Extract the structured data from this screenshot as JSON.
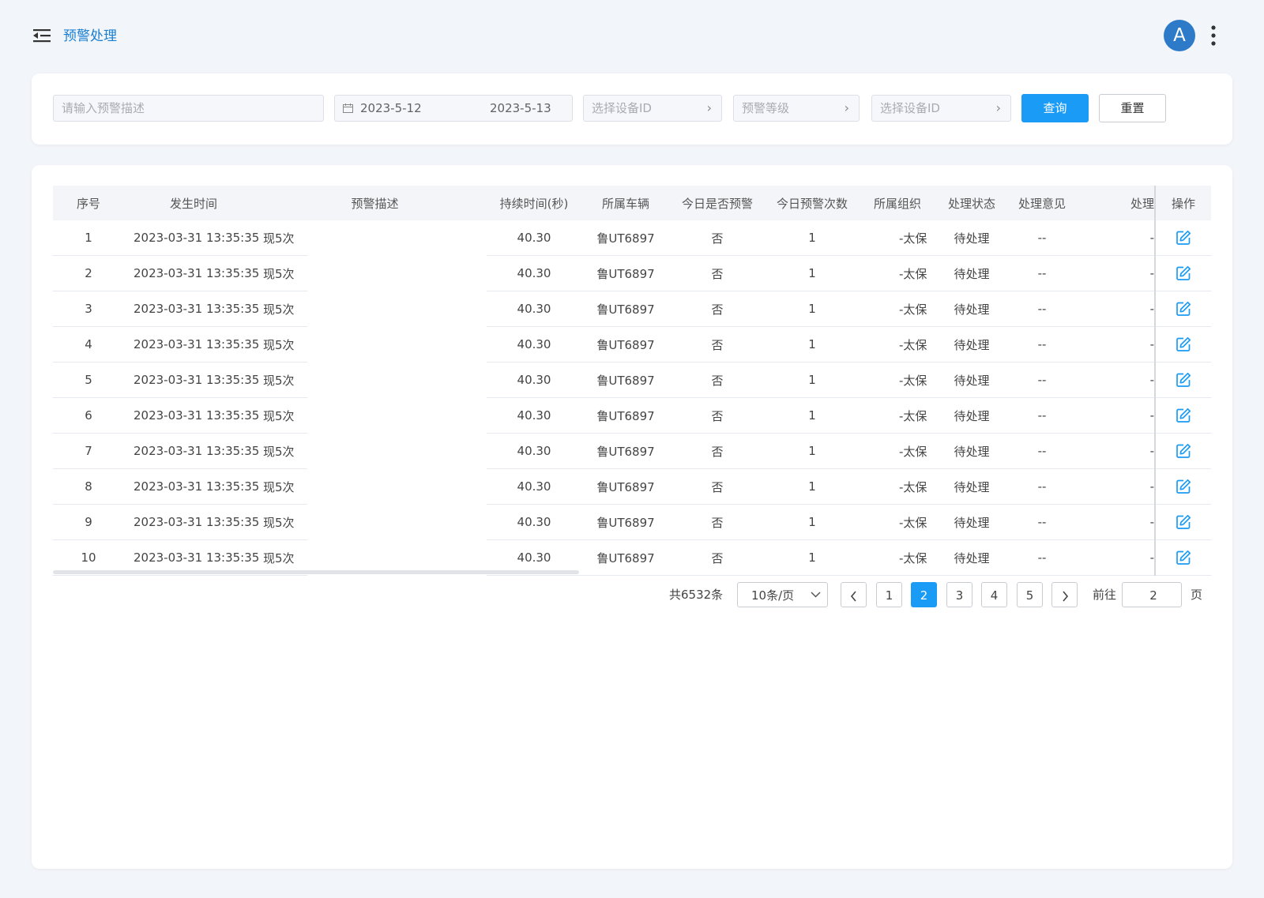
{
  "header": {
    "title": "预警处理",
    "avatar_letter": "A"
  },
  "filters": {
    "desc_placeholder": "请输入预警描述",
    "date_start": "2023-5-12",
    "date_end": "2023-5-13",
    "device_placeholder": "选择设备ID",
    "level_placeholder": "预警等级",
    "device2_placeholder": "选择设备ID",
    "query_label": "查询",
    "reset_label": "重置"
  },
  "table": {
    "columns": [
      "序号",
      "发生时间",
      "预警描述",
      "持续时间(秒)",
      "所属车辆",
      "今日是否预警",
      "今日预警次数",
      "所属组织",
      "处理状态",
      "处理意见",
      "处理",
      "操作"
    ],
    "rows": [
      {
        "index": "1",
        "time": "2023-03-31 13:35:35",
        "desc": "现5次",
        "duration": "40.30",
        "vehicle": "鲁UT6897",
        "today_alert": "否",
        "today_count": "1",
        "org": "-太保",
        "status": "待处理",
        "opinion": "--",
        "handler": "-"
      },
      {
        "index": "2",
        "time": "2023-03-31 13:35:35",
        "desc": "现5次",
        "duration": "40.30",
        "vehicle": "鲁UT6897",
        "today_alert": "否",
        "today_count": "1",
        "org": "-太保",
        "status": "待处理",
        "opinion": "--",
        "handler": "-"
      },
      {
        "index": "3",
        "time": "2023-03-31 13:35:35",
        "desc": "现5次",
        "duration": "40.30",
        "vehicle": "鲁UT6897",
        "today_alert": "否",
        "today_count": "1",
        "org": "-太保",
        "status": "待处理",
        "opinion": "--",
        "handler": "-"
      },
      {
        "index": "4",
        "time": "2023-03-31 13:35:35",
        "desc": "现5次",
        "duration": "40.30",
        "vehicle": "鲁UT6897",
        "today_alert": "否",
        "today_count": "1",
        "org": "-太保",
        "status": "待处理",
        "opinion": "--",
        "handler": "-"
      },
      {
        "index": "5",
        "time": "2023-03-31 13:35:35",
        "desc": "现5次",
        "duration": "40.30",
        "vehicle": "鲁UT6897",
        "today_alert": "否",
        "today_count": "1",
        "org": "-太保",
        "status": "待处理",
        "opinion": "--",
        "handler": "-"
      },
      {
        "index": "6",
        "time": "2023-03-31 13:35:35",
        "desc": "现5次",
        "duration": "40.30",
        "vehicle": "鲁UT6897",
        "today_alert": "否",
        "today_count": "1",
        "org": "-太保",
        "status": "待处理",
        "opinion": "--",
        "handler": "-"
      },
      {
        "index": "7",
        "time": "2023-03-31 13:35:35",
        "desc": "现5次",
        "duration": "40.30",
        "vehicle": "鲁UT6897",
        "today_alert": "否",
        "today_count": "1",
        "org": "-太保",
        "status": "待处理",
        "opinion": "--",
        "handler": "-"
      },
      {
        "index": "8",
        "time": "2023-03-31 13:35:35",
        "desc": "现5次",
        "duration": "40.30",
        "vehicle": "鲁UT6897",
        "today_alert": "否",
        "today_count": "1",
        "org": "-太保",
        "status": "待处理",
        "opinion": "--",
        "handler": "-"
      },
      {
        "index": "9",
        "time": "2023-03-31 13:35:35",
        "desc": "现5次",
        "duration": "40.30",
        "vehicle": "鲁UT6897",
        "today_alert": "否",
        "today_count": "1",
        "org": "-太保",
        "status": "待处理",
        "opinion": "--",
        "handler": "-"
      },
      {
        "index": "10",
        "time": "2023-03-31 13:35:35",
        "desc": "现5次",
        "duration": "40.30",
        "vehicle": "鲁UT6897",
        "today_alert": "否",
        "today_count": "1",
        "org": "-太保",
        "status": "待处理",
        "opinion": "--",
        "handler": "-"
      }
    ],
    "action_icon": "edit-icon"
  },
  "pagination": {
    "total": "共6532条",
    "page_size": "10条/页",
    "pages": [
      "1",
      "2",
      "3",
      "4",
      "5"
    ],
    "current": "2",
    "goto_label": "前往",
    "goto_value": "2",
    "unit": "页"
  },
  "colors": {
    "accent": "#1a9bf5",
    "title": "#1a7fd1",
    "avatar": "#2d7bc8",
    "background": "#f2f5fa"
  }
}
